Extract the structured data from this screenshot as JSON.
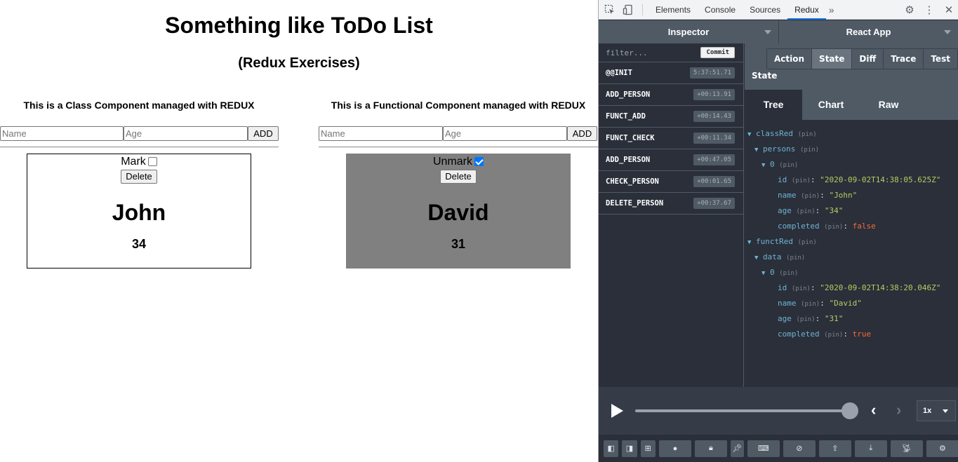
{
  "app": {
    "title": "Something like ToDo List",
    "subtitle": "(Redux Exercises)",
    "class_panel": {
      "title": "This is a Class Component managed with REDUX",
      "name_placeholder": "Name",
      "age_placeholder": "Age",
      "add_label": "ADD",
      "card": {
        "mark_label": "Mark",
        "checked": false,
        "delete_label": "Delete",
        "name": "John",
        "age": "34"
      }
    },
    "func_panel": {
      "title": "This is a Functional Component managed with REDUX",
      "name_placeholder": "Name",
      "age_placeholder": "Age",
      "add_label": "ADD",
      "card": {
        "mark_label": "Unmark",
        "checked": true,
        "delete_label": "Delete",
        "name": "David",
        "age": "31"
      }
    }
  },
  "devtools": {
    "tabs": [
      "Elements",
      "Console",
      "Sources",
      "Redux"
    ],
    "active_tab": "Redux",
    "more": "»",
    "icons": {
      "inspect": "inspect-icon",
      "device": "device-icon",
      "settings": "gear-icon",
      "menu": "kebab-menu-icon",
      "close": "close-icon"
    },
    "monitor": "Inspector",
    "instance": "React App",
    "filter_placeholder": "filter...",
    "commit_label": "Commit",
    "actions": [
      {
        "name": "@@INIT",
        "time": "5:37:51.71"
      },
      {
        "name": "ADD_PERSON",
        "time": "+00:13.91"
      },
      {
        "name": "FUNCT_ADD",
        "time": "+00:14.43"
      },
      {
        "name": "FUNCT_CHECK",
        "time": "+00:11.34"
      },
      {
        "name": "ADD_PERSON",
        "time": "+00:47.05"
      },
      {
        "name": "CHECK_PERSON",
        "time": "+00:01.65"
      },
      {
        "name": "DELETE_PERSON",
        "time": "+00:37.67"
      }
    ],
    "inspector_tabs": [
      "Action",
      "State",
      "Diff",
      "Trace",
      "Test"
    ],
    "inspector_active": "State",
    "state_label": "State",
    "view_tabs": [
      "Tree",
      "Chart",
      "Raw"
    ],
    "view_active": "Tree",
    "pin": "(pin)",
    "tree": {
      "classRed": "classRed",
      "persons": "persons",
      "idx0a": "0",
      "id_key": "id",
      "name_key": "name",
      "age_key": "age",
      "completed_key": "completed",
      "john_id": "\"2020-09-02T14:38:05.625Z\"",
      "john_name": "\"John\"",
      "john_age": "\"34\"",
      "john_completed": "false",
      "functRed": "functRed",
      "data": "data",
      "idx0b": "0",
      "david_id": "\"2020-09-02T14:38:20.046Z\"",
      "david_name": "\"David\"",
      "david_age": "\"31\"",
      "david_completed": "true"
    },
    "slider_position": 1.0,
    "speed": "1x"
  }
}
